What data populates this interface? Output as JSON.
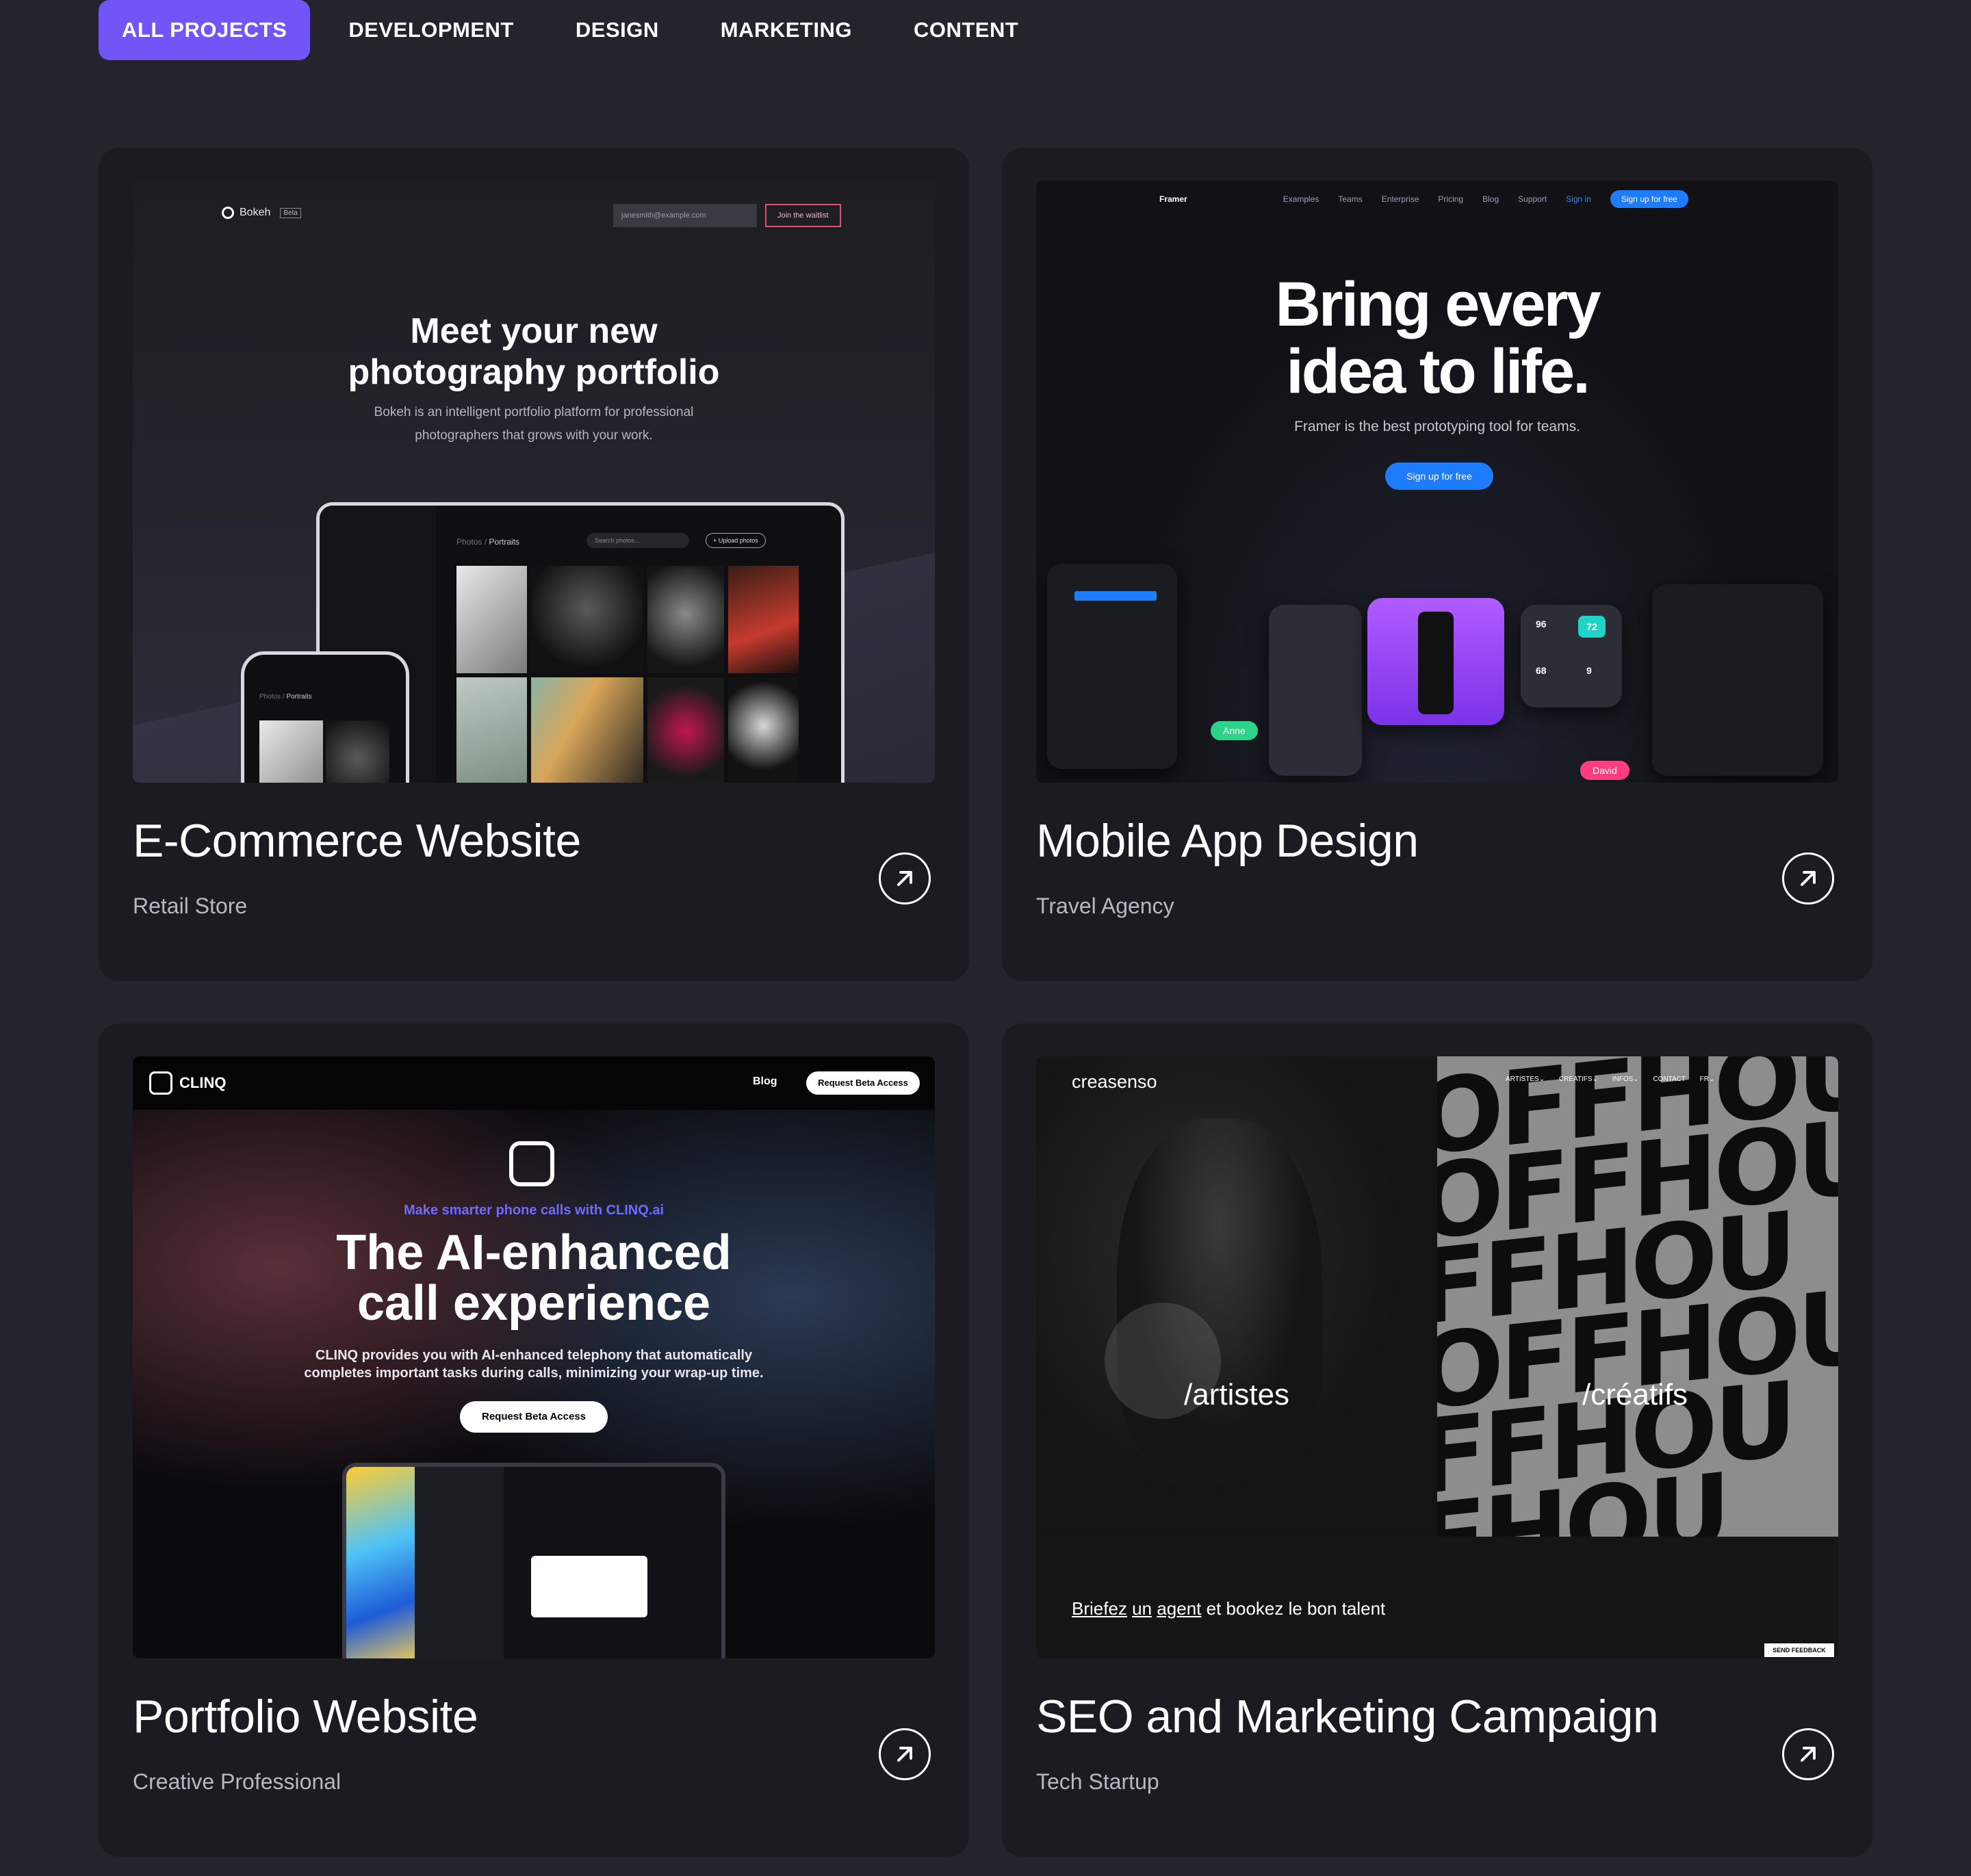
{
  "tabs": [
    {
      "label": "ALL PROJECTS",
      "active": true
    },
    {
      "label": "DEVELOPMENT",
      "active": false
    },
    {
      "label": "DESIGN",
      "active": false
    },
    {
      "label": "MARKETING",
      "active": false
    },
    {
      "label": "CONTENT",
      "active": false
    }
  ],
  "accent_color": "#7155f6",
  "projects": [
    {
      "title": "E-Commerce Website",
      "subtitle": "Retail Store",
      "preview": {
        "brand": "Bokeh",
        "badge": "Beta",
        "email_placeholder": "janesmith@example.com",
        "cta": "Join the waitlist",
        "headline_1": "Meet your new",
        "headline_2": "photography portfolio",
        "body_1": "Bokeh is an intelligent portfolio platform for professional",
        "body_2": "photographers that grows with your work.",
        "breadcrumb_root": "Photos /",
        "breadcrumb_page": "Portraits",
        "search_placeholder": "Search photos...",
        "upload": "+ Upload photos"
      }
    },
    {
      "title": "Mobile App Design",
      "subtitle": "Travel Agency",
      "preview": {
        "brand": "Framer",
        "nav": [
          "Examples",
          "Teams",
          "Enterprise",
          "Pricing",
          "Blog",
          "Support"
        ],
        "signin": "Sign in",
        "nav_cta": "Sign up for free",
        "headline_1": "Bring every",
        "headline_2": "idea to life.",
        "body": "Framer is the best prototyping tool for teams.",
        "cta": "Sign up for free",
        "chip_1": "Anne",
        "chip_2": "David",
        "stats": [
          "96",
          "72",
          "68",
          "9"
        ]
      }
    },
    {
      "title": "Portfolio Website",
      "subtitle": "Creative Professional",
      "preview": {
        "brand": "CLINQ",
        "nav_blog": "Blog",
        "nav_cta": "Request Beta Access",
        "kicker": "Make smarter phone calls with CLINQ.ai",
        "headline_1": "The AI-enhanced",
        "headline_2": "call experience",
        "body_1": "CLINQ provides you with AI-enhanced telephony that automatically",
        "body_2": "completes important tasks during calls, minimizing your wrap-up time.",
        "cta": "Request Beta Access"
      }
    },
    {
      "title": "SEO and Marketing Campaign",
      "subtitle": "Tech Startup",
      "preview": {
        "brand": "creasenso",
        "menu": "ARTISTES⌄ CREATIFS⌄ INFOS⌄ CONTACT FR⌄",
        "label_left": "/artistes",
        "label_right": "/créatifs",
        "poster_text": [
          "OFFHOU",
          "OFFHOU",
          "FFHOU",
          "OFFHOUF",
          "FFHOU",
          "FHOU"
        ],
        "tag_1": "Briefez",
        "tag_2": "un",
        "tag_3": "agent",
        "tag_4": "et bookez le bon talent",
        "feedback": "SEND FEEDBACK"
      }
    }
  ]
}
